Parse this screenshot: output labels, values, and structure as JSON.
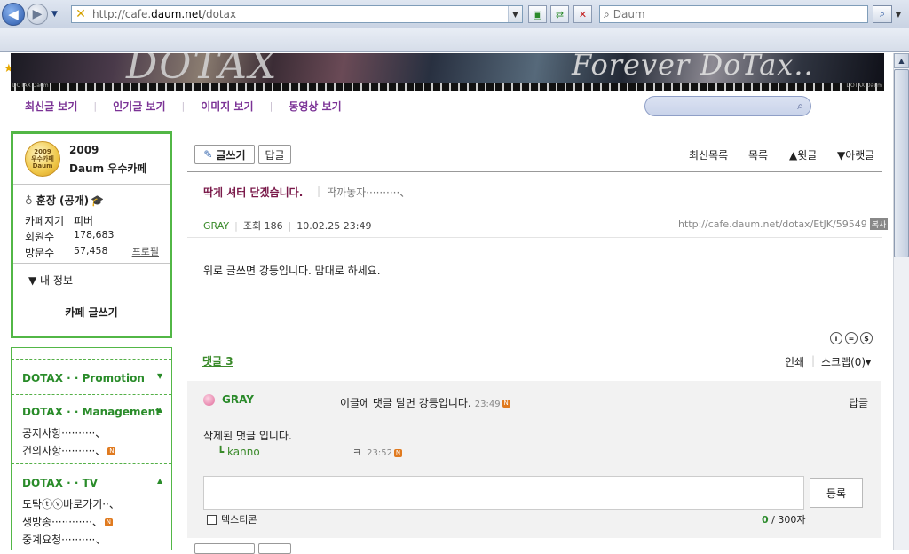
{
  "browser": {
    "url_prefix": "http://cafe.",
    "url_domain": "daum.net",
    "url_path": "/dotax",
    "search_placeholder": "Daum"
  },
  "banner": {
    "title_left": "DOTAX",
    "title_right": "Forever DoTax..",
    "small_left": "DOTAX Daum",
    "small_right": "DOTAX Daum"
  },
  "tabs": [
    "최신글 보기",
    "인기글 보기",
    "이미지 보기",
    "동영상 보기"
  ],
  "cafe_info": {
    "badge_year": "2009",
    "badge_line1": "우수카페",
    "badge_line2": "Daum",
    "year": "2009",
    "award": "Daum 우수카페",
    "owner": "훈장 (공개)",
    "keeper_label": "카페지기",
    "keeper_value": "피버",
    "members_label": "회원수",
    "members_value": "178,683",
    "visitors_label": "방문수",
    "visitors_value": "57,458",
    "profile_link": "프로필",
    "my_info": "▼ 내 정보",
    "write_button": "카페 글쓰기"
  },
  "menu": {
    "sections": [
      {
        "title": "DOTAX · · Promotion",
        "arrow": "▼"
      },
      {
        "title": "DOTAX · · Management",
        "arrow": "▲"
      },
      {
        "title": "DOTAX · · TV",
        "arrow": "▲"
      }
    ],
    "items": [
      "공지사항··········、",
      "건의사항··········、",
      "도탁ⓣⓥ바로가기··、",
      "생방송············、",
      "중계요청··········、"
    ],
    "new_badge": "N"
  },
  "post": {
    "write_button": "글쓰기",
    "reply_button": "답글",
    "nav_recent": "최신목록",
    "nav_list": "목록",
    "nav_prev": "▲윗글",
    "nav_next": "▼아랫글",
    "title": "딱게 셔터 닫겠습니다.",
    "author_line": "딱까놓자··········、",
    "meta_name": "GRAY",
    "meta_views": "조회 186",
    "meta_date": "10.02.25 23:49",
    "permalink": "http://cafe.daum.net/dotax/EtJK/59549",
    "copy_label": "복사",
    "content": "위로 글쓰면 강등입니다. 맘대로 하세요.",
    "cc_icons": [
      "i",
      "=",
      "$"
    ]
  },
  "comments": {
    "count_label": "댓글 3",
    "print_label": "인쇄",
    "scrap_label": "스크랩(0)▾",
    "first_user": "GRAY",
    "first_text": "이글에 댓글 달면 강등입니다.",
    "first_time": "23:49",
    "reply_label": "답글",
    "deleted_text": "삭제된 댓글 입니다.",
    "sub_user": "┗ kanno",
    "sub_text": "ㅋ",
    "sub_time": "23:52",
    "register_button": "등록",
    "emoticon_label": "텍스티콘",
    "char_count": "0",
    "char_max": "/ 300자"
  }
}
